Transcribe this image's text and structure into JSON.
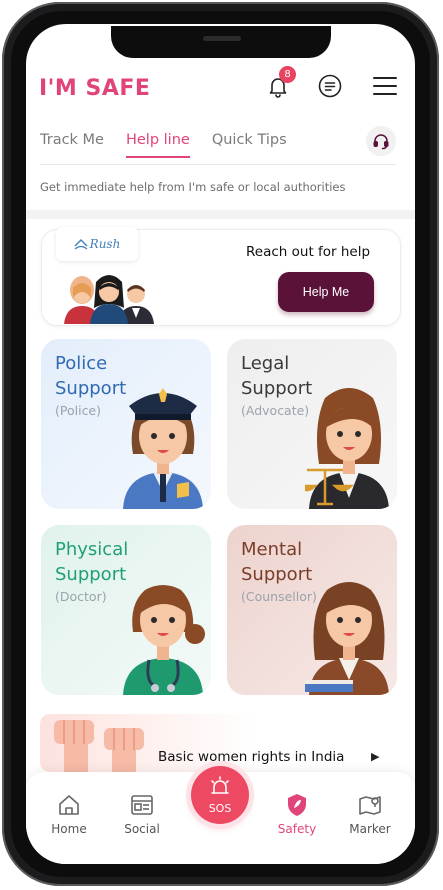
{
  "app": {
    "title": "I'M SAFE",
    "notification_count": "8"
  },
  "tabs": [
    {
      "label": "Track Me",
      "active": false
    },
    {
      "label": "Help line",
      "active": true
    },
    {
      "label": "Quick Tips",
      "active": false
    }
  ],
  "subtitle": "Get immediate help from I'm safe or local authorities",
  "help_card": {
    "logo_text": "Rush",
    "reach_text": "Reach out for help",
    "button_label": "Help Me"
  },
  "support_tiles": [
    {
      "line1": "Police",
      "line2": "Support",
      "role": "(Police)"
    },
    {
      "line1": "Legal",
      "line2": "Support",
      "role": "(Advocate)"
    },
    {
      "line1": "Physical",
      "line2": "Support",
      "role": "(Doctor)"
    },
    {
      "line1": "Mental",
      "line2": "Support",
      "role": "(Counsellor)"
    }
  ],
  "rights_banner": {
    "text": "Basic women rights in India"
  },
  "bottom_nav": [
    {
      "label": "Home",
      "icon": "home-icon"
    },
    {
      "label": "Social",
      "icon": "social-icon"
    },
    {
      "label": "SOS",
      "icon": "siren-icon"
    },
    {
      "label": "Safety",
      "icon": "shield-icon",
      "active": true
    },
    {
      "label": "Marker",
      "icon": "map-marker-icon"
    }
  ],
  "colors": {
    "brand": "#e0447a",
    "button": "#5a1239",
    "sos": "#ee4962"
  }
}
